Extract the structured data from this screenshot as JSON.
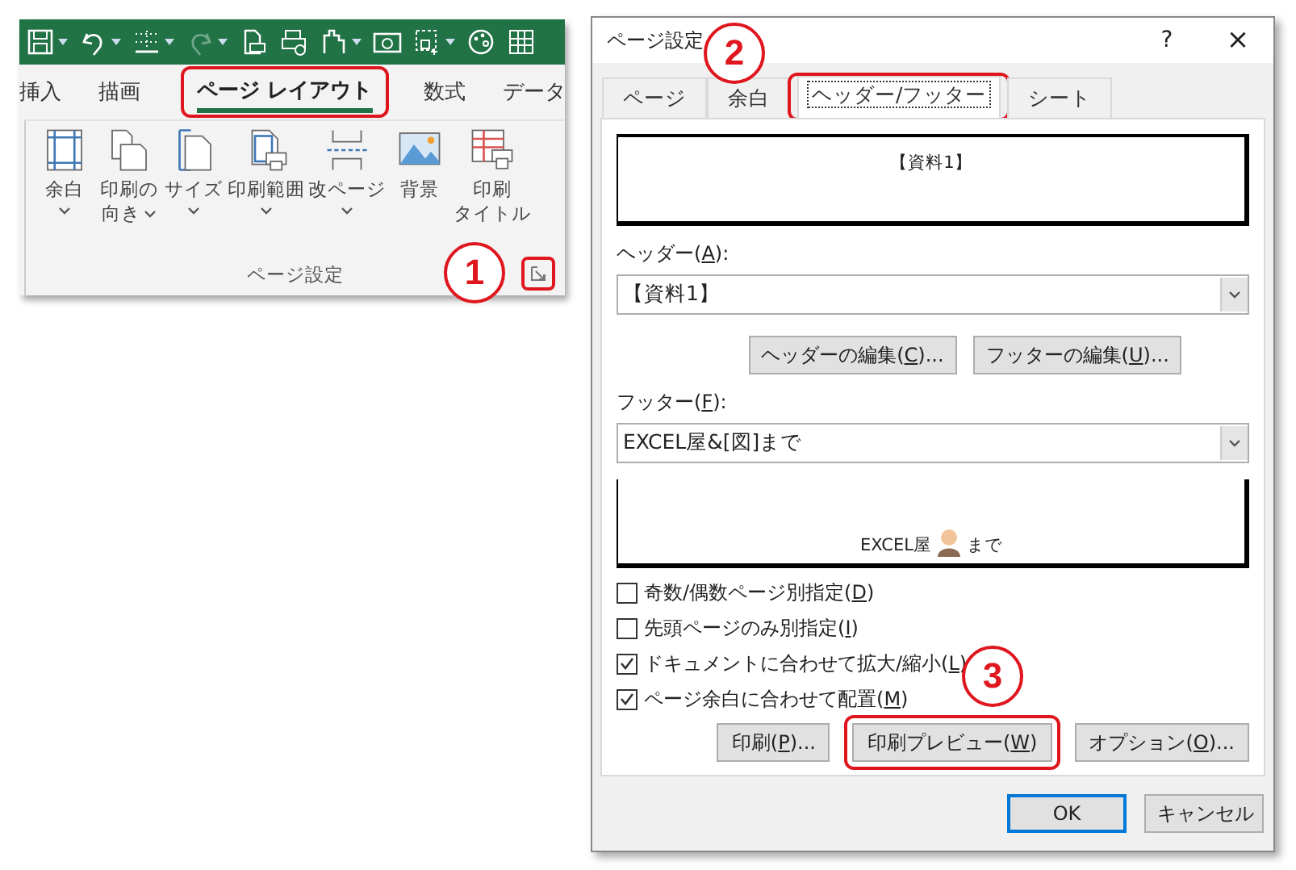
{
  "ribbon": {
    "tabs": [
      {
        "label": "挿入",
        "selected": false,
        "highlighted": false
      },
      {
        "label": "描画",
        "selected": false,
        "highlighted": false
      },
      {
        "label": "ページ レイアウト",
        "selected": true,
        "highlighted": true
      },
      {
        "label": "数式",
        "selected": false,
        "highlighted": false
      },
      {
        "label": "データ",
        "selected": false,
        "highlighted": false
      }
    ],
    "buttons": [
      {
        "lines": [
          "余白"
        ],
        "dropdown": true
      },
      {
        "lines": [
          "印刷の",
          "向き"
        ],
        "dropdown": true
      },
      {
        "lines": [
          "サイズ"
        ],
        "dropdown": true
      },
      {
        "lines": [
          "印刷範囲"
        ],
        "dropdown": true
      },
      {
        "lines": [
          "改ページ"
        ],
        "dropdown": true
      },
      {
        "lines": [
          "背景"
        ],
        "dropdown": false
      },
      {
        "lines": [
          "印刷",
          "タイトル"
        ],
        "dropdown": false
      }
    ],
    "group_label": "ページ設定",
    "launcher": {
      "highlighted": true
    }
  },
  "dialog": {
    "title": "ページ設定",
    "help": "?",
    "close": "×",
    "tabs": [
      {
        "label": "ページ",
        "selected": false,
        "highlighted": false
      },
      {
        "label": "余白",
        "selected": false,
        "highlighted": false
      },
      {
        "label": "ヘッダー/フッター",
        "selected": true,
        "highlighted": true
      },
      {
        "label": "シート",
        "selected": false,
        "highlighted": false
      }
    ],
    "header_preview": "【資料1】",
    "header_label": [
      "ヘッダー(",
      "A",
      "):"
    ],
    "header_value": "【資料1】",
    "edit_buttons": [
      {
        "label": [
          "ヘッダーの編集(",
          "C",
          ")..."
        ]
      },
      {
        "label": [
          "フッターの編集(",
          "U",
          ")..."
        ]
      }
    ],
    "footer_label": [
      "フッター(",
      "F",
      "):"
    ],
    "footer_value": "EXCEL屋&[図]まで",
    "footer_preview": {
      "before": "EXCEL屋",
      "after": "まで"
    },
    "checkboxes": [
      {
        "label": [
          "奇数/偶数ページ別指定(",
          "D",
          ")"
        ],
        "checked": false
      },
      {
        "label": [
          "先頭ページのみ別指定(",
          "I",
          ")"
        ],
        "checked": false
      },
      {
        "label": [
          "ドキュメントに合わせて拡大/縮小(",
          "L",
          ")"
        ],
        "checked": true
      },
      {
        "label": [
          "ページ余白に合わせて配置(",
          "M",
          ")"
        ],
        "checked": true
      }
    ],
    "action_buttons": [
      {
        "label": [
          "印刷(",
          "P",
          ")..."
        ],
        "highlighted": false
      },
      {
        "label": [
          "印刷プレビュー(",
          "W",
          ")"
        ],
        "highlighted": true
      },
      {
        "label": [
          "オプション(",
          "O",
          ")..."
        ],
        "highlighted": false
      }
    ],
    "footer_buttons": [
      {
        "label": "OK",
        "default": true
      },
      {
        "label": "キャンセル",
        "default": false
      }
    ]
  },
  "callouts": [
    {
      "label": "1"
    },
    {
      "label": "2"
    },
    {
      "label": "3"
    }
  ]
}
